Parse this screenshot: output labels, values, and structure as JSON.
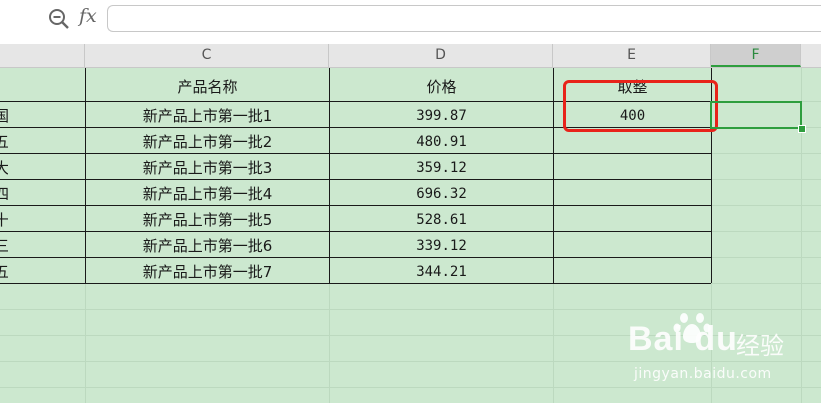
{
  "formula_bar": {
    "fx_label": "fx",
    "value": ""
  },
  "columns": [
    {
      "id": "C",
      "label": "C"
    },
    {
      "id": "D",
      "label": "D"
    },
    {
      "id": "E",
      "label": "E"
    },
    {
      "id": "F",
      "label": "F"
    }
  ],
  "headers": {
    "name": "产品名称",
    "price": "价格",
    "rounded": "取整"
  },
  "rows": [
    {
      "stub": "国",
      "name": "新产品上市第一批1",
      "price": "399.87",
      "rounded": "400"
    },
    {
      "stub": "五",
      "name": "新产品上市第一批2",
      "price": "480.91",
      "rounded": ""
    },
    {
      "stub": "大",
      "name": "新产品上市第一批3",
      "price": "359.12",
      "rounded": ""
    },
    {
      "stub": "四",
      "name": "新产品上市第一批4",
      "price": "696.32",
      "rounded": ""
    },
    {
      "stub": "十",
      "name": "新产品上市第一批5",
      "price": "528.61",
      "rounded": ""
    },
    {
      "stub": "三",
      "name": "新产品上市第一批6",
      "price": "339.12",
      "rounded": ""
    },
    {
      "stub": "五",
      "name": "新产品上市第一批7",
      "price": "344.21",
      "rounded": ""
    }
  ],
  "watermark": {
    "logo": "Bai du",
    "text": "经验",
    "url": "jingyan.baidu.com"
  },
  "colors": {
    "sheet_bg": "#cce8cf",
    "highlight_box": "#e8231a",
    "selection": "#2e9e3e"
  }
}
